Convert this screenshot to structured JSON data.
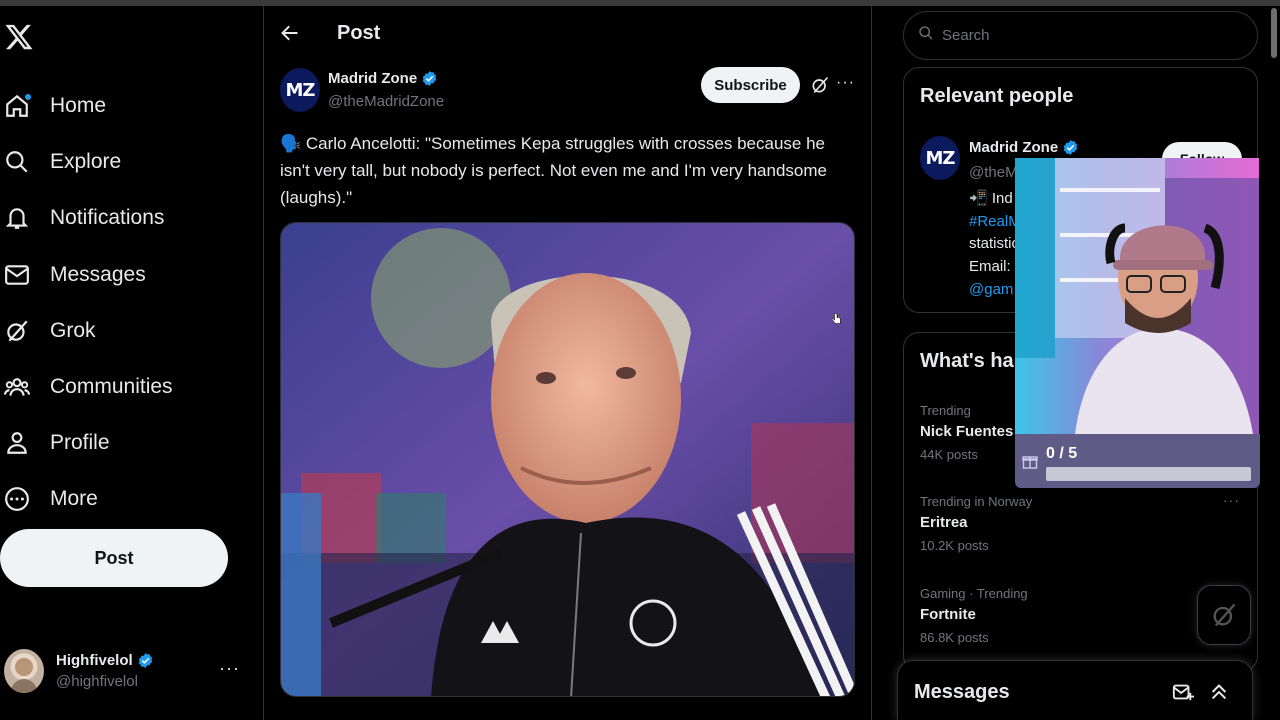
{
  "nav": {
    "items": [
      {
        "label": "Home",
        "icon": "home-icon"
      },
      {
        "label": "Explore",
        "icon": "search-icon"
      },
      {
        "label": "Notifications",
        "icon": "bell-icon"
      },
      {
        "label": "Messages",
        "icon": "mail-icon"
      },
      {
        "label": "Grok",
        "icon": "grok-icon"
      },
      {
        "label": "Communities",
        "icon": "people-icon"
      },
      {
        "label": "Profile",
        "icon": "person-icon"
      },
      {
        "label": "More",
        "icon": "more-circle-icon"
      }
    ],
    "post_label": "Post"
  },
  "account": {
    "name": "Highfivelol",
    "handle": "@highfivelol",
    "more": "···"
  },
  "header": {
    "title": "Post"
  },
  "post": {
    "author_name": "Madrid Zone",
    "author_handle": "@theMadridZone",
    "avatar_text": "MZ",
    "subscribe_label": "Subscribe",
    "more": "···",
    "text": "🗣️ Carlo Ancelotti: \"Sometimes Kepa struggles with crosses because he isn't very tall, but nobody is perfect. Not even me and I'm very handsome (laughs).\""
  },
  "search": {
    "placeholder": "Search"
  },
  "relevant": {
    "title": "Relevant people",
    "name": "Madrid Zone",
    "handle": "@theM",
    "follow_label": "Follow",
    "bio_line1": "📲 Ind",
    "bio_tag": "#RealM",
    "bio_line3": "statistic",
    "bio_line4": "Email: c",
    "bio_link": "@gam"
  },
  "happening": {
    "title": "What's ha",
    "trends": [
      {
        "context": "Trending",
        "name": "Nick Fuentes",
        "count": "44K posts"
      },
      {
        "context": "Trending in Norway",
        "name": "Eritrea",
        "count": "10.2K posts"
      },
      {
        "context": "Gaming · Trending",
        "name": "Fortnite",
        "count": "86.8K posts"
      }
    ]
  },
  "messages": {
    "title": "Messages"
  },
  "overlay": {
    "counter": "0 / 5",
    "progress": 0
  },
  "colors": {
    "accent": "#1d9bf0",
    "background": "#000000",
    "border": "#2f3336"
  }
}
